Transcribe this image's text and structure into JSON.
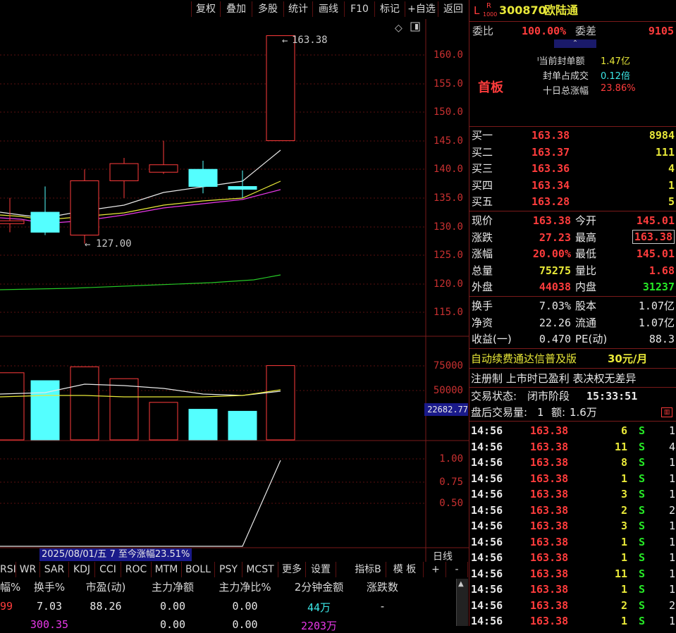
{
  "toolbar": {
    "buttons": [
      "复权",
      "叠加",
      "多股",
      "统计",
      "画线",
      "F10",
      "标记",
      "+自选",
      "返回"
    ]
  },
  "chart": {
    "price_axis": [
      "160.0",
      "155.0",
      "150.0",
      "145.0",
      "140.0",
      "135.0",
      "130.0",
      "125.0",
      "120.0",
      "115.0"
    ],
    "high_marker": "163.38",
    "low_marker": "127.00",
    "volume_axis": [
      "75000",
      "50000"
    ],
    "volume_current": "22682.77",
    "indicator_axis": [
      "1.00",
      "0.75",
      "0.50"
    ],
    "date_range_text": "2025/08/01/五 7 至今涨幅23.51%",
    "period_label": "日线",
    "candles": [
      {
        "o": 130.5,
        "c": 131.0,
        "h": 135.0,
        "l": 129.0,
        "up": true
      },
      {
        "o": 132.5,
        "c": 129.0,
        "h": 137.0,
        "l": 128.5,
        "up": false
      },
      {
        "o": 128.5,
        "c": 138.0,
        "h": 140.0,
        "l": 127.0,
        "up": true
      },
      {
        "o": 138.0,
        "c": 141.0,
        "h": 142.0,
        "l": 135.0,
        "up": true
      },
      {
        "o": 139.5,
        "c": 140.8,
        "h": 145.0,
        "l": 139.2,
        "up": true
      },
      {
        "o": 140.0,
        "c": 137.0,
        "h": 141.5,
        "l": 135.8,
        "up": false
      },
      {
        "o": 137.0,
        "c": 136.5,
        "h": 139.8,
        "l": 135.0,
        "up": false
      },
      {
        "o": 145.01,
        "c": 163.38,
        "h": 163.38,
        "l": 145.01,
        "up": true
      }
    ],
    "volumes": [
      {
        "v": 68000,
        "up": true
      },
      {
        "v": 60000,
        "up": false
      },
      {
        "v": 74000,
        "up": true
      },
      {
        "v": 62000,
        "up": true
      },
      {
        "v": 38000,
        "up": true
      },
      {
        "v": 31000,
        "up": false
      },
      {
        "v": 29000,
        "up": false
      },
      {
        "v": 75275,
        "up": true
      }
    ]
  },
  "tabs": [
    "RSI",
    "WR",
    "SAR",
    "KDJ",
    "CCI",
    "ROC",
    "MTM",
    "BOLL",
    "PSY",
    "MCST",
    "更多",
    "设置",
    "指标B",
    "模 板",
    "+",
    "-"
  ],
  "bottom": {
    "headers": [
      "幅%",
      "换手%",
      "市盈(动)",
      "主力净额",
      "主力净比%",
      "2分钟金额",
      "涨跌数"
    ],
    "row1": [
      "99",
      "7.03",
      "88.26",
      "0.00",
      "0.00",
      "44万",
      "-"
    ],
    "row2": [
      "",
      "300.35",
      "",
      "0.00",
      "0.00",
      "2203万",
      ""
    ]
  },
  "quote": {
    "badge_l": "L",
    "badge_r": "R",
    "badge_sub": "1000",
    "code": "300870",
    "name": "欧陆通",
    "weibi_label": "委比",
    "weibi_value": "100.00%",
    "weicha_label": "委差",
    "weicha_value": "9105",
    "seal_amount_label": "当前封单额",
    "seal_amount_value": "1.47亿",
    "seal_ratio_label": "封单占成交",
    "seal_ratio_value": "0.12倍",
    "ten_day_label": "十日总涨幅",
    "ten_day_value": "23.86%",
    "board_label": "首板",
    "bids": [
      {
        "label": "买一",
        "price": "163.38",
        "vol": "8984"
      },
      {
        "label": "买二",
        "price": "163.37",
        "vol": "111"
      },
      {
        "label": "买三",
        "price": "163.36",
        "vol": "4"
      },
      {
        "label": "买四",
        "price": "163.34",
        "vol": "1"
      },
      {
        "label": "买五",
        "price": "163.28",
        "vol": "5"
      }
    ],
    "stats": [
      {
        "l1": "现价",
        "v1": "163.38",
        "l2": "今开",
        "v2": "145.01"
      },
      {
        "l1": "涨跌",
        "v1": "27.23",
        "l2": "最高",
        "v2": "163.38"
      },
      {
        "l1": "涨幅",
        "v1": "20.00%",
        "l2": "最低",
        "v2": "145.01"
      },
      {
        "l1": "总量",
        "v1": "75275",
        "l2": "量比",
        "v2": "1.68"
      },
      {
        "l1": "外盘",
        "v1": "44038",
        "l2": "内盘",
        "v2": "31237"
      }
    ],
    "stats2": [
      {
        "l1": "换手",
        "v1": "7.03%",
        "l2": "股本",
        "v2": "1.07亿"
      },
      {
        "l1": "净资",
        "v1": "22.26",
        "l2": "流通",
        "v2": "1.07亿"
      },
      {
        "l1": "收益(一)",
        "v1": "0.470",
        "l2": "PE(动)",
        "v2": "88.3"
      }
    ],
    "ad_text": "自动续费通达信普及版",
    "ad_price": "30元/月",
    "tags_text": "注册制 上市时已盈利 表决权无差异",
    "status_label": "交易状态:",
    "status_value": "闭市阶段",
    "status_time": "15:33:51",
    "after_label": "盘后交易量:",
    "after_vol": "1",
    "after_amt_label": "额:",
    "after_amt": "1.6万",
    "ticks": [
      {
        "t": "14:56",
        "p": "163.38",
        "v": "6",
        "s": "S",
        "n": "1"
      },
      {
        "t": "14:56",
        "p": "163.38",
        "v": "11",
        "s": "S",
        "n": "4"
      },
      {
        "t": "14:56",
        "p": "163.38",
        "v": "8",
        "s": "S",
        "n": "1"
      },
      {
        "t": "14:56",
        "p": "163.38",
        "v": "1",
        "s": "S",
        "n": "1"
      },
      {
        "t": "14:56",
        "p": "163.38",
        "v": "3",
        "s": "S",
        "n": "1"
      },
      {
        "t": "14:56",
        "p": "163.38",
        "v": "2",
        "s": "S",
        "n": "2"
      },
      {
        "t": "14:56",
        "p": "163.38",
        "v": "3",
        "s": "S",
        "n": "1"
      },
      {
        "t": "14:56",
        "p": "163.38",
        "v": "1",
        "s": "S",
        "n": "1"
      },
      {
        "t": "14:56",
        "p": "163.38",
        "v": "1",
        "s": "S",
        "n": "1"
      },
      {
        "t": "14:56",
        "p": "163.38",
        "v": "11",
        "s": "S",
        "n": "1"
      },
      {
        "t": "14:56",
        "p": "163.38",
        "v": "1",
        "s": "S",
        "n": "1"
      },
      {
        "t": "14:56",
        "p": "163.38",
        "v": "2",
        "s": "S",
        "n": "2"
      },
      {
        "t": "14:56",
        "p": "163.38",
        "v": "1",
        "s": "S",
        "n": "1"
      }
    ]
  }
}
